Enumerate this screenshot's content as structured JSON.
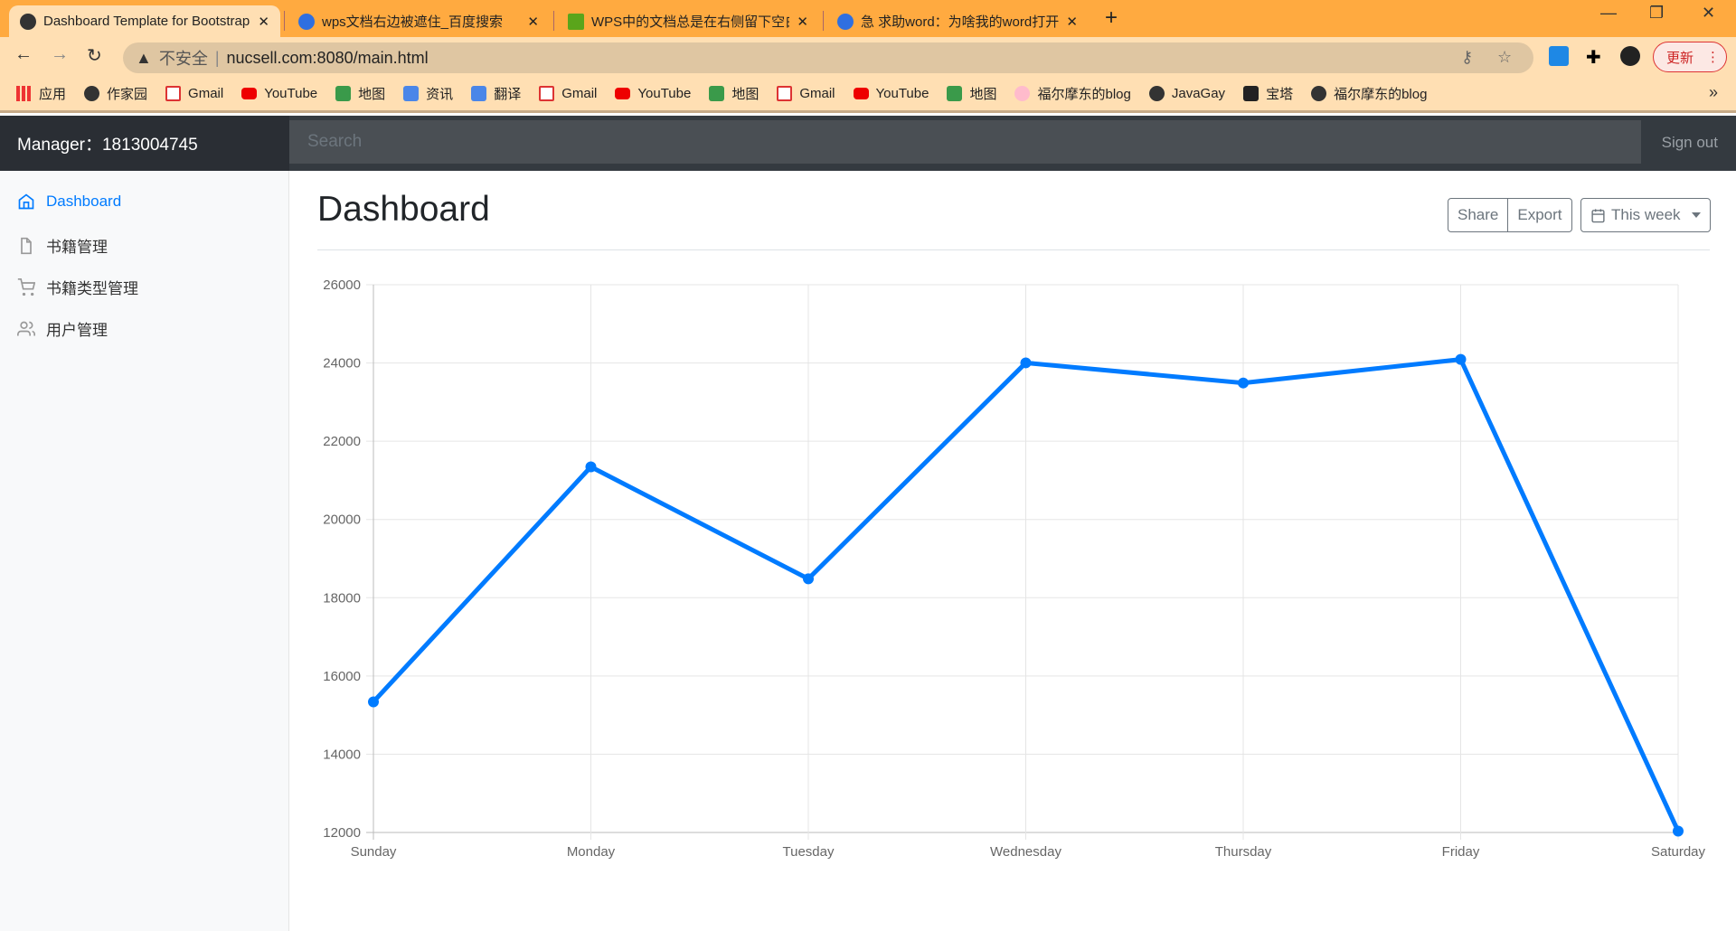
{
  "browser": {
    "tabs": [
      {
        "title": "Dashboard Template for Bootstrap",
        "icon": "globe-icon",
        "active": true
      },
      {
        "title": "wps文档右边被遮住_百度搜索",
        "icon": "baidu-icon"
      },
      {
        "title": "WPS中的文档总是在右侧留下空白",
        "icon": "wps-icon"
      },
      {
        "title": "急 求助word：为啥我的word打开",
        "icon": "baidu-icon"
      }
    ],
    "address": {
      "security": "不安全",
      "url": "nucsell.com:8080/main.html"
    },
    "update_label": "更新",
    "bookmarks": [
      {
        "label": "应用",
        "icon": "apps"
      },
      {
        "label": "作家园",
        "icon": "globe"
      },
      {
        "label": "Gmail",
        "icon": "gm"
      },
      {
        "label": "YouTube",
        "icon": "yt"
      },
      {
        "label": "地图",
        "icon": "map"
      },
      {
        "label": "资讯",
        "icon": "news"
      },
      {
        "label": "翻译",
        "icon": "news"
      },
      {
        "label": "Gmail",
        "icon": "gm"
      },
      {
        "label": "YouTube",
        "icon": "yt"
      },
      {
        "label": "地图",
        "icon": "map"
      },
      {
        "label": "Gmail",
        "icon": "gm"
      },
      {
        "label": "YouTube",
        "icon": "yt"
      },
      {
        "label": "地图",
        "icon": "map"
      },
      {
        "label": "福尔摩东的blog",
        "icon": "sakura"
      },
      {
        "label": "JavaGay",
        "icon": "globe"
      },
      {
        "label": "宝塔",
        "icon": "bt"
      },
      {
        "label": "福尔摩东的blog",
        "icon": "globe"
      }
    ]
  },
  "navbar": {
    "brand": "Manager：1813004745",
    "search_placeholder": "Search",
    "signout": "Sign out"
  },
  "sidebar": {
    "items": [
      {
        "label": "Dashboard",
        "active": true
      },
      {
        "label": "书籍管理"
      },
      {
        "label": "书籍类型管理"
      },
      {
        "label": "用户管理"
      }
    ]
  },
  "main": {
    "title": "Dashboard",
    "share": "Share",
    "export": "Export",
    "period": "This week"
  },
  "chart_data": {
    "type": "line",
    "categories": [
      "Sunday",
      "Monday",
      "Tuesday",
      "Wednesday",
      "Thursday",
      "Friday",
      "Saturday"
    ],
    "values": [
      15339,
      21345,
      18483,
      24003,
      23489,
      24092,
      12034
    ],
    "ylim": [
      12000,
      26000
    ],
    "yticks": [
      12000,
      14000,
      16000,
      18000,
      20000,
      22000,
      24000,
      26000
    ],
    "grid": true,
    "color": "#007bff"
  }
}
